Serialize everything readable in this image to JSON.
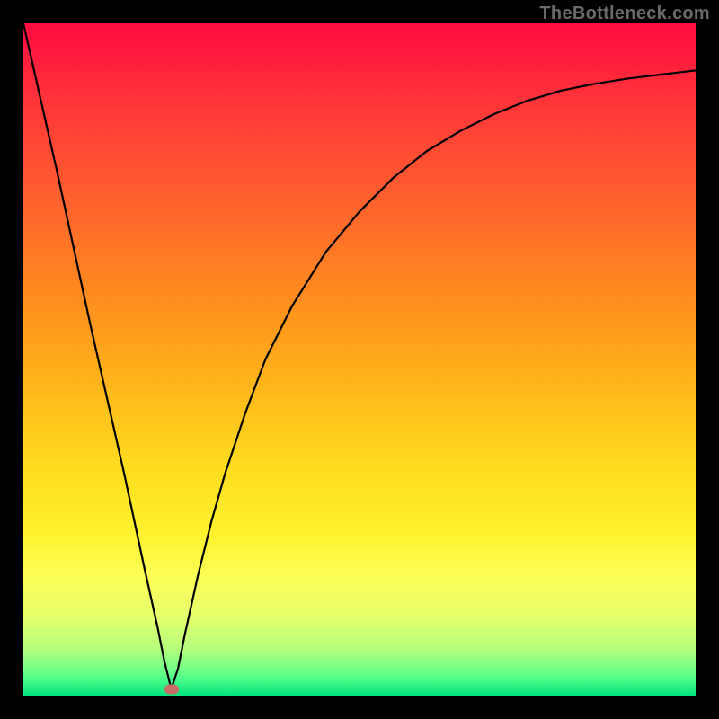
{
  "watermark": "TheBottleneck.com",
  "colors": {
    "frame": "#000000",
    "curve": "#000000",
    "marker": "#c96d68",
    "gradient_top": "#ff0a40",
    "gradient_bottom": "#00e57e"
  },
  "chart_data": {
    "type": "line",
    "title": "",
    "xlabel": "",
    "ylabel": "",
    "xlim": [
      0,
      100
    ],
    "ylim": [
      0,
      100
    ],
    "grid": false,
    "legend": false,
    "annotations": [
      {
        "label": "min-marker",
        "x": 22,
        "y": 1
      }
    ],
    "series": [
      {
        "name": "bottleneck-curve",
        "x": [
          0,
          5,
          10,
          15,
          18,
          20,
          21,
          22,
          23,
          24,
          26,
          28,
          30,
          33,
          36,
          40,
          45,
          50,
          55,
          60,
          65,
          70,
          75,
          80,
          85,
          90,
          95,
          100
        ],
        "values": [
          100,
          78,
          55,
          33,
          19,
          10,
          5,
          1,
          4,
          9,
          18,
          26,
          33,
          42,
          50,
          58,
          66,
          72,
          77,
          81,
          84,
          86.5,
          88.5,
          90,
          91,
          91.8,
          92.4,
          93
        ]
      }
    ],
    "marker": {
      "x": 22,
      "y": 1
    }
  }
}
